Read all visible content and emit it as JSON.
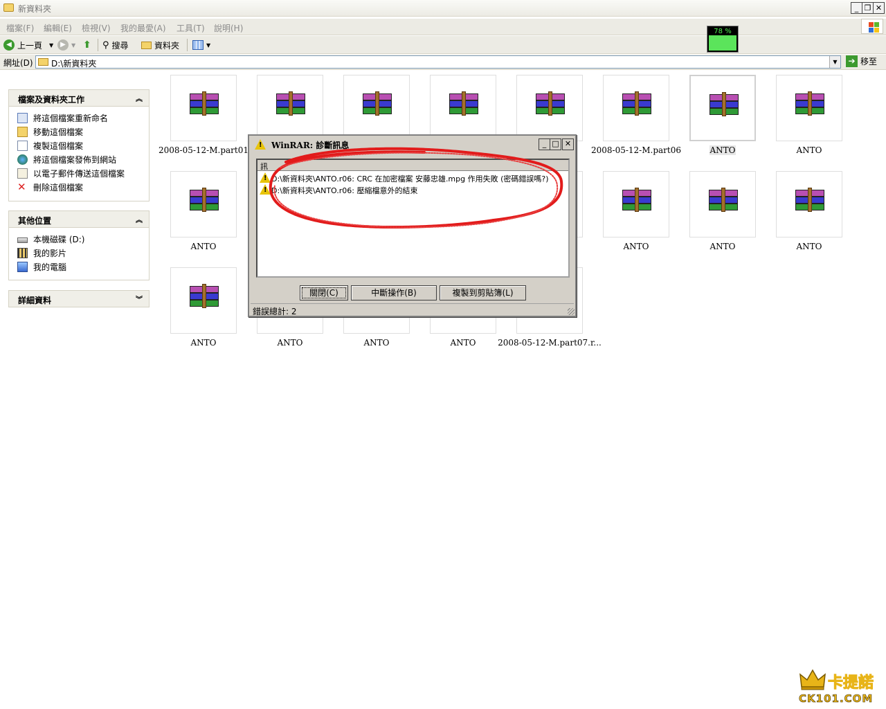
{
  "window": {
    "title": "新資料夾"
  },
  "menu": [
    "檔案(F)",
    "編輯(E)",
    "檢視(V)",
    "我的最愛(A)",
    "工具(T)",
    "說明(H)"
  ],
  "cpu_meter": {
    "label": "78 %",
    "level": 0.78,
    "color": "#5be45b"
  },
  "toolbar": {
    "back_label": "上一頁",
    "search_label": "搜尋",
    "folders_label": "資料夾"
  },
  "address": {
    "label": "網址(D)",
    "value": "D:\\新資料夾",
    "go_label": "移至"
  },
  "panes": {
    "tasks": {
      "title": "檔案及資料夾工作",
      "items": [
        "將這個檔案重新命名",
        "移動這個檔案",
        "複製這個檔案",
        "將這個檔案發佈到網站",
        "以電子郵件傳送這個檔案",
        "刪除這個檔案"
      ]
    },
    "places": {
      "title": "其他位置",
      "items": [
        "本機磁碟 (D:)",
        "我的影片",
        "我的電腦"
      ]
    },
    "details": {
      "title": "詳細資料"
    }
  },
  "files": [
    {
      "name": "2008-05-12-M.part01"
    },
    {
      "name": ""
    },
    {
      "name": ""
    },
    {
      "name": ""
    },
    {
      "name": "05"
    },
    {
      "name": "2008-05-12-M.part06"
    },
    {
      "name": "ANTO",
      "selected": true
    },
    {
      "name": "ANTO"
    },
    {
      "name": "ANTO"
    },
    {
      "name": ""
    },
    {
      "name": ""
    },
    {
      "name": ""
    },
    {
      "name": ""
    },
    {
      "name": "ANTO"
    },
    {
      "name": "ANTO"
    },
    {
      "name": "ANTO"
    },
    {
      "name": "ANTO"
    },
    {
      "name": "ANTO"
    },
    {
      "name": "ANTO"
    },
    {
      "name": "ANTO"
    },
    {
      "name": "2008-05-12-M.part07.r..."
    }
  ],
  "dialog": {
    "title": "WinRAR: 診斷訊息",
    "column_header": "訊",
    "messages": [
      "D:\\新資料夾\\ANTO.r06: CRC 在加密檔案 安藤忠雄.mpg 作用失敗 (密碼錯誤嗎?)",
      "D:\\新資料夾\\ANTO.r06: 壓縮檔意外的結束"
    ],
    "buttons": {
      "close": "關閉(C)",
      "abort": "中斷操作(B)",
      "copy": "複製到剪貼簿(L)"
    },
    "status": "錯誤總計: 2"
  },
  "watermark": {
    "brand": "卡提諾",
    "url": "CK101.COM"
  }
}
